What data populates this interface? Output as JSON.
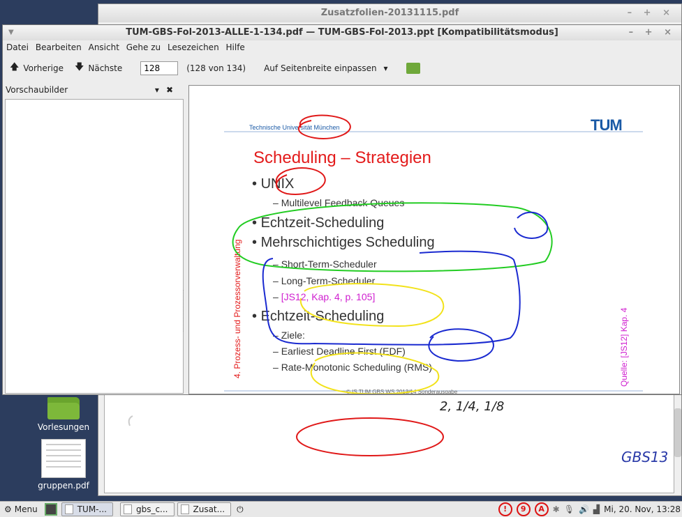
{
  "desktop": {
    "folder_label": "Vorlesungen",
    "pdf_label": "gruppen.pdf"
  },
  "bg_window": {
    "title": "Zusatzfolien-20131115.pdf",
    "controls": "– + ×",
    "handwriting_bottom": "2, 1/4, 1/8",
    "handwriting_right": "GBS13"
  },
  "window": {
    "title": "TUM-GBS-Fol-2013-ALLE-1-134.pdf — TUM-GBS-Fol-2013.ppt [Kompatibilitätsmodus]",
    "controls": "– + ×",
    "menu": [
      "Datei",
      "Bearbeiten",
      "Ansicht",
      "Gehe zu",
      "Lesezeichen",
      "Hilfe"
    ],
    "toolbar": {
      "prev_label": "Vorherige",
      "next_label": "Nächste",
      "page_value": "128",
      "page_info": "(128 von 134)",
      "zoom_label": "Auf Seitenbreite einpassen"
    },
    "sidebar": {
      "title": "Vorschaubilder"
    }
  },
  "slide": {
    "header": "Technische Universität München",
    "logo": "TUM",
    "title": "Scheduling – Strategien",
    "side_left": "4. Prozess- und Prozessorverwaltung",
    "side_right": "Quelle: [JS12] Kap. 4",
    "bullets": [
      {
        "level": 1,
        "text": "UNIX"
      },
      {
        "level": 2,
        "text": "Multilevel Feedback Queues"
      },
      {
        "level": 1,
        "text": "Echtzeit-Scheduling"
      },
      {
        "level": 1,
        "text": "Mehrschichtiges Scheduling"
      },
      {
        "level": 2,
        "text": "Short-Term-Scheduler"
      },
      {
        "level": 2,
        "text": "Long-Term-Scheduler"
      },
      {
        "level": 2,
        "text": "[JS12, Kap. 4, p. 105]"
      },
      {
        "level": 1,
        "text": "Echtzeit-Scheduling"
      },
      {
        "level": 2,
        "text": "Ziele:"
      },
      {
        "level": 2,
        "text": "Earliest Deadline First (EDF)"
      },
      {
        "level": 2,
        "text": "Rate-Monotonic Scheduling (RMS)"
      }
    ],
    "footer": "© IS TUM GBS WS 2013/14 Sonderausgabe",
    "colors": {
      "title": "#e31a1a",
      "magenta": "#d020d0",
      "blue": "#1a5aa6"
    }
  },
  "taskbar": {
    "menu_label": "Menu",
    "items": [
      "TUM-...",
      "gbs_c...",
      "Zusat..."
    ],
    "tray_badges": [
      "!",
      "9",
      "A"
    ],
    "clock": "Mi, 20. Nov, 13:28"
  }
}
